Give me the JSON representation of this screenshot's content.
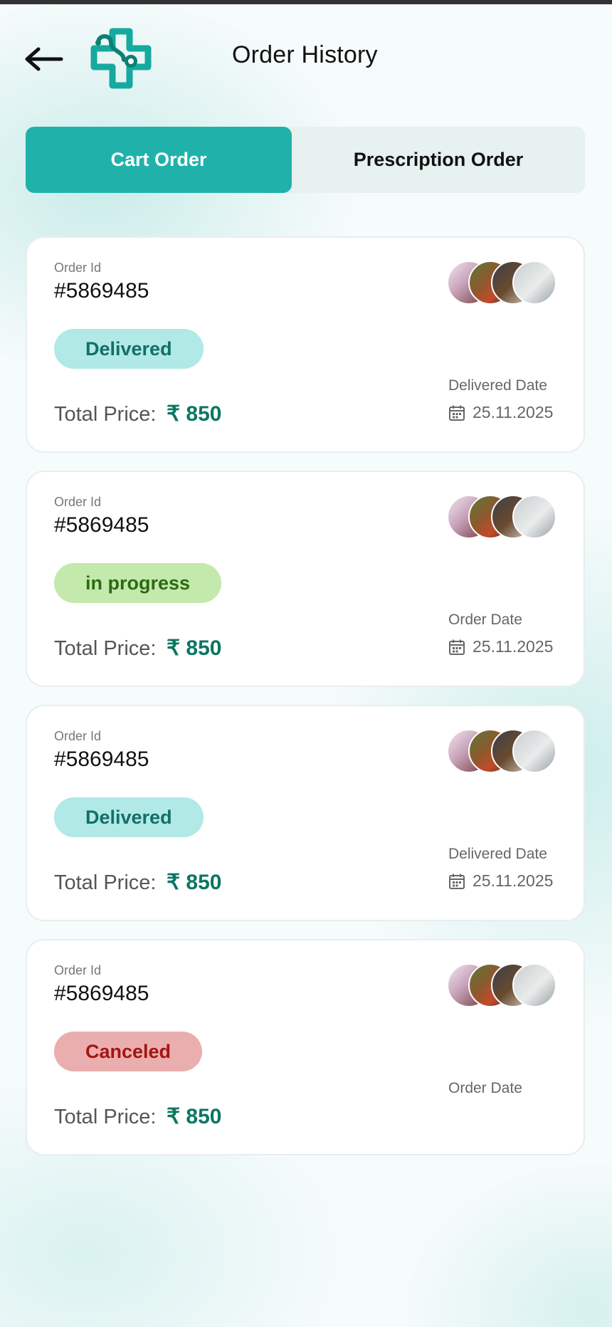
{
  "header": {
    "title": "Order History",
    "back_icon": "arrow-left-icon",
    "logo_icon": "medical-cross-stethoscope-logo"
  },
  "tabs": [
    {
      "label": "Cart Order",
      "active": true
    },
    {
      "label": "Prescription Order",
      "active": false
    }
  ],
  "colors": {
    "accent": "#20b2aa",
    "price": "#0b7662",
    "delivered_bg": "#b0e9e5",
    "progress_bg": "#c3e9ac",
    "canceled_bg": "#eaaeae"
  },
  "orders": [
    {
      "order_id_label": "Order Id",
      "order_id": "#5869485",
      "status": "Delivered",
      "total_label": "Total Price:",
      "total_value": "₹ 850",
      "date_label": "Delivered Date",
      "date": "25.11.2025"
    },
    {
      "order_id_label": "Order Id",
      "order_id": "#5869485",
      "status": "in progress",
      "total_label": "Total Price:",
      "total_value": "₹ 850",
      "date_label": "Order Date",
      "date": "25.11.2025"
    },
    {
      "order_id_label": "Order Id",
      "order_id": "#5869485",
      "status": "Delivered",
      "total_label": "Total Price:",
      "total_value": "₹ 850",
      "date_label": "Delivered Date",
      "date": "25.11.2025"
    },
    {
      "order_id_label": "Order Id",
      "order_id": "#5869485",
      "status": "Canceled",
      "total_label": "Total Price:",
      "total_value": "₹ 850",
      "date_label": "Order Date",
      "date": ""
    }
  ]
}
